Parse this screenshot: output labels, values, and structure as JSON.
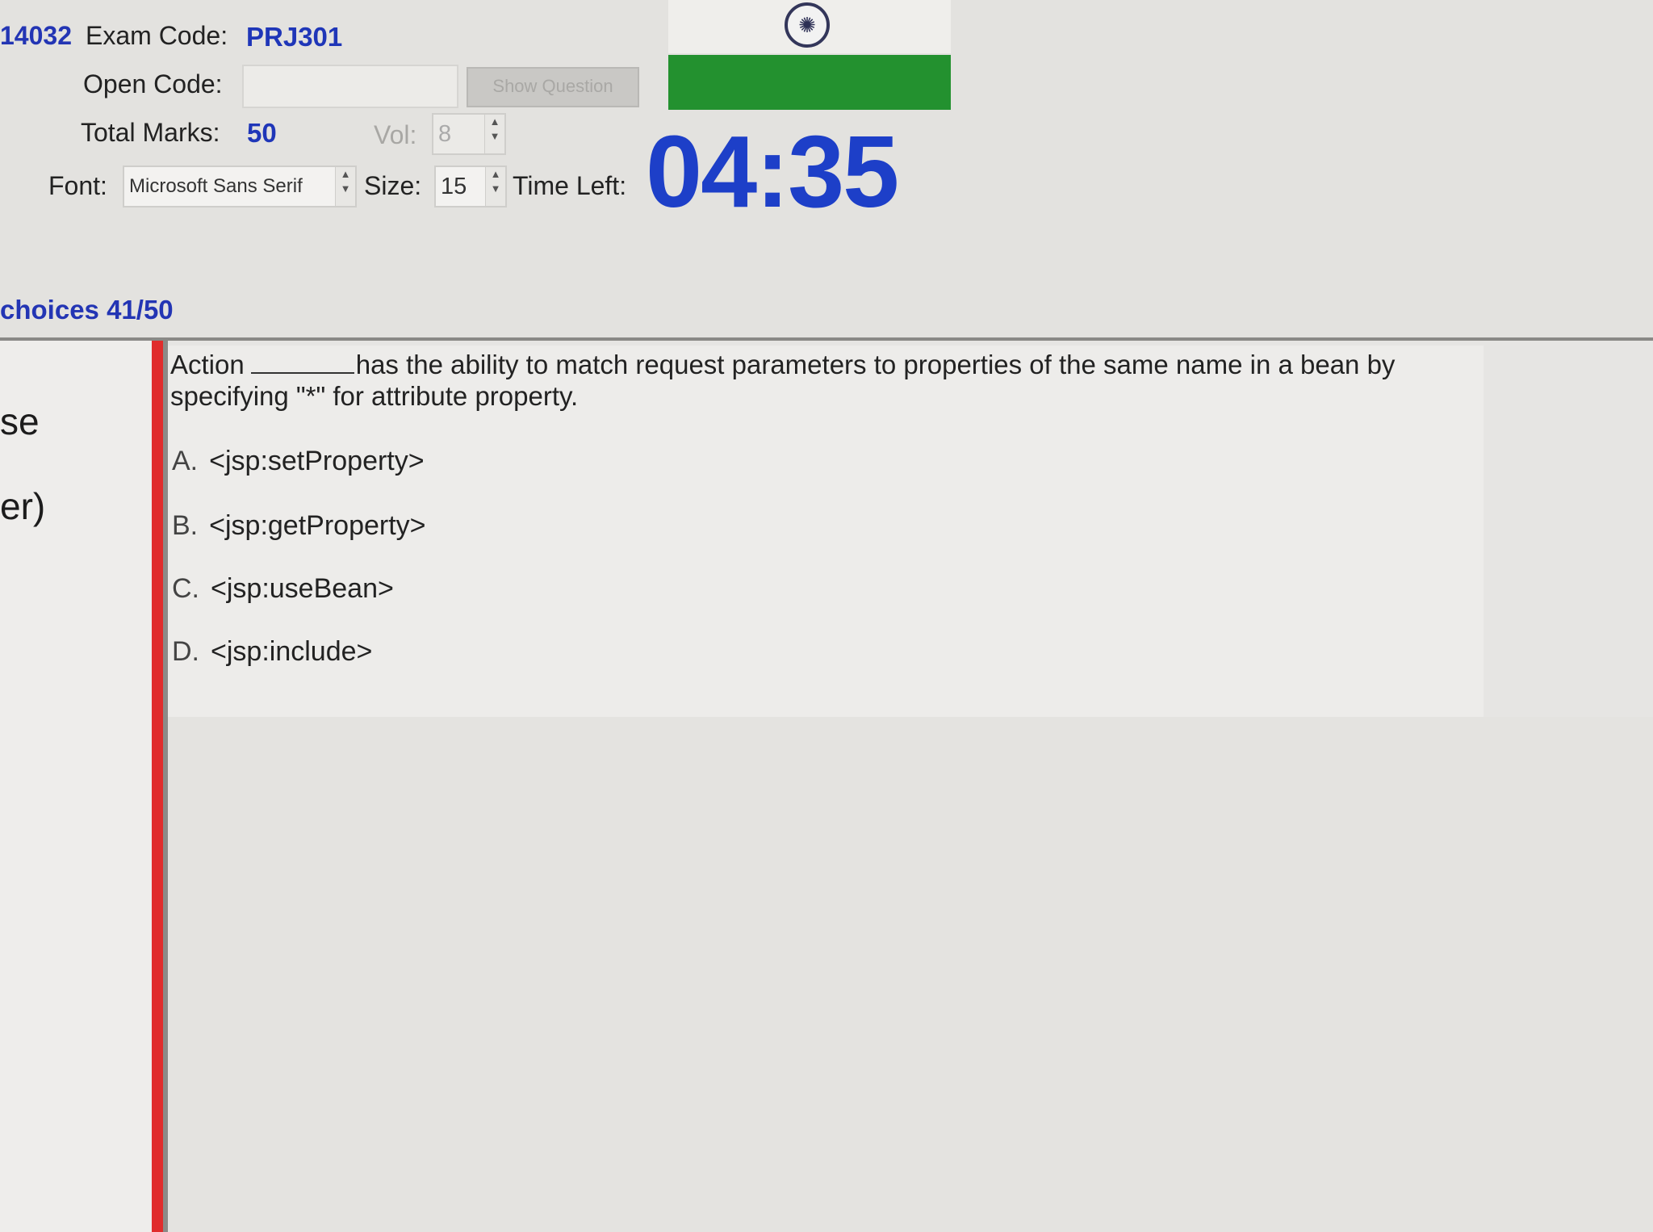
{
  "header": {
    "exam_id": "14032",
    "exam_code_label": "Exam Code:",
    "exam_code": "PRJ301",
    "open_code_label": "Open Code:",
    "open_code_value": "",
    "show_question_label": "Show Question",
    "total_marks_label": "Total Marks:",
    "total_marks": "50",
    "vol_label": "Vol:",
    "vol_value": "8",
    "font_label": "Font:",
    "font_value": "Microsoft Sans Serif",
    "size_label": "Size:",
    "size_value": "15",
    "time_left_label": "Time Left:",
    "time_left": "04:35",
    "status_bar_color": "#23912f",
    "timer_color": "#1d3fc8"
  },
  "section": {
    "choices_title": "choices 41/50"
  },
  "left_panel": {
    "fragment_1": "se",
    "fragment_2": "er)"
  },
  "question": {
    "text_part1": "Action",
    "text_part2": "has the ability to match request parameters to properties of the same name in a bean by",
    "text_part3": "specifying \"*\" for attribute property.",
    "options": [
      {
        "letter": "A.",
        "text": "<jsp:setProperty>"
      },
      {
        "letter": "B.",
        "text": "<jsp:getProperty>"
      },
      {
        "letter": "C.",
        "text": "<jsp:useBean>"
      },
      {
        "letter": "D.",
        "text": "<jsp:include>"
      }
    ]
  }
}
